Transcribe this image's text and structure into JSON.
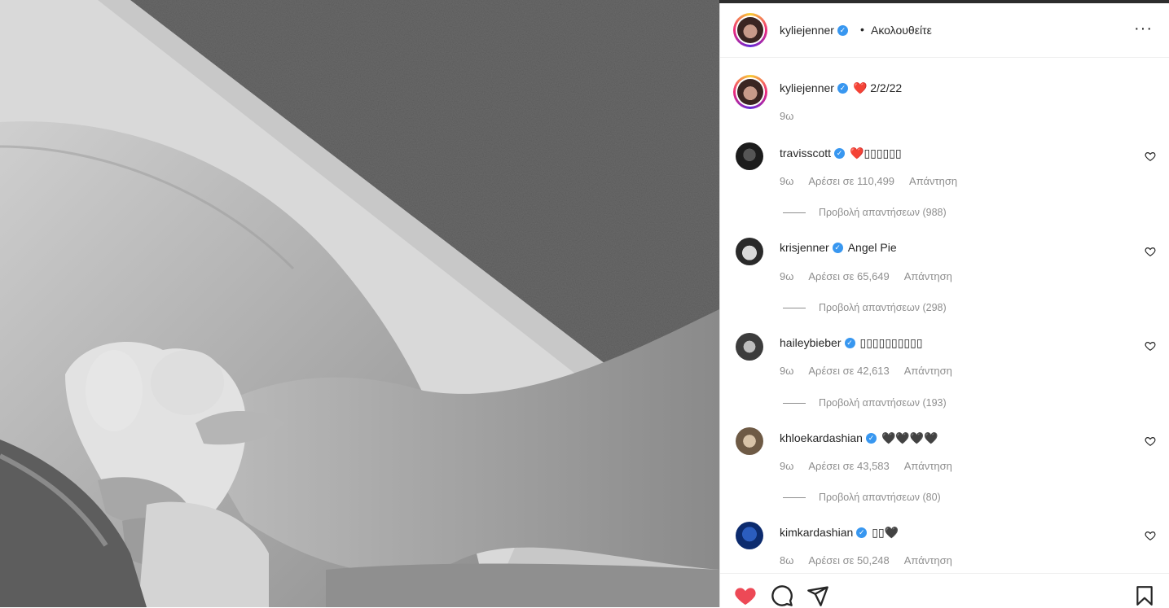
{
  "post": {
    "author": "kyliejenner",
    "follow_label": "Ακολουθείτε",
    "more_icon": "more-horizontal-icon",
    "caption_text": "❤️ 2/2/22",
    "caption_time": "9ω"
  },
  "comments": [
    {
      "user": "travisscott",
      "text": "❤️▯▯▯▯▯▯",
      "time": "9ω",
      "likes": "Αρέσει σε 110,499",
      "reply": "Απάντηση",
      "view_replies": "Προβολή απαντήσεων (988)"
    },
    {
      "user": "krisjenner",
      "text": "Angel Pie",
      "time": "9ω",
      "likes": "Αρέσει σε 65,649",
      "reply": "Απάντηση",
      "view_replies": "Προβολή απαντήσεων (298)"
    },
    {
      "user": "haileybieber",
      "text": "▯▯▯▯▯▯▯▯▯▯",
      "time": "9ω",
      "likes": "Αρέσει σε 42,613",
      "reply": "Απάντηση",
      "view_replies": "Προβολή απαντήσεων (193)"
    },
    {
      "user": "khloekardashian",
      "text": "🖤🖤🖤🖤",
      "time": "9ω",
      "likes": "Αρέσει σε 43,583",
      "reply": "Απάντηση",
      "view_replies": "Προβολή απαντήσεων (80)"
    },
    {
      "user": "kimkardashian",
      "text": "▯▯🖤",
      "time": "8ω",
      "likes": "Αρέσει σε 50,248",
      "reply": "Απάντηση",
      "view_replies": ""
    }
  ],
  "actions": {
    "like_icon": "heart-filled-icon",
    "comment_icon": "comment-icon",
    "share_icon": "send-icon",
    "save_icon": "bookmark-icon",
    "like_color": "#ed4956"
  }
}
